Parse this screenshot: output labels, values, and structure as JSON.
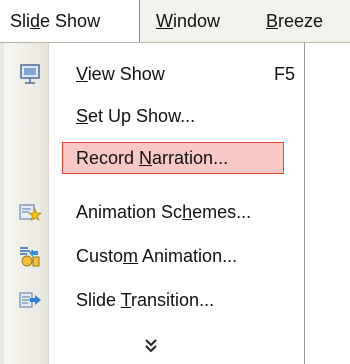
{
  "menubar": {
    "slide_show": {
      "pre": "Sli",
      "u": "d",
      "post": "e Show"
    },
    "window": {
      "pre": "",
      "u": "W",
      "post": "indow"
    },
    "breeze": {
      "pre": "",
      "u": "B",
      "post": "reeze"
    }
  },
  "menu": {
    "view_show": {
      "pre": "",
      "u": "V",
      "post": "iew Show",
      "shortcut": "F5"
    },
    "set_up_show": {
      "pre": "",
      "u": "S",
      "post": "et Up Show..."
    },
    "record_narration": {
      "pre": "Record ",
      "u": "N",
      "post": "arration..."
    },
    "animation_schemes": {
      "pre": "Animation Sc",
      "u": "h",
      "post": "emes..."
    },
    "custom_animation": {
      "pre": "Custo",
      "u": "m",
      "post": " Animation..."
    },
    "slide_transition": {
      "pre": "Slide ",
      "u": "T",
      "post": "ransition..."
    }
  },
  "colors": {
    "highlight_fill": "#f8c9c4",
    "highlight_border": "#e04a3c",
    "menubar_bg": "#f3f2ec"
  },
  "icons": {
    "view_show": "projector-screen-icon",
    "animation_schemes": "star-animation-icon",
    "custom_animation": "custom-animation-icon",
    "slide_transition": "slide-transition-icon",
    "expand": "double-chevron-down-icon"
  }
}
